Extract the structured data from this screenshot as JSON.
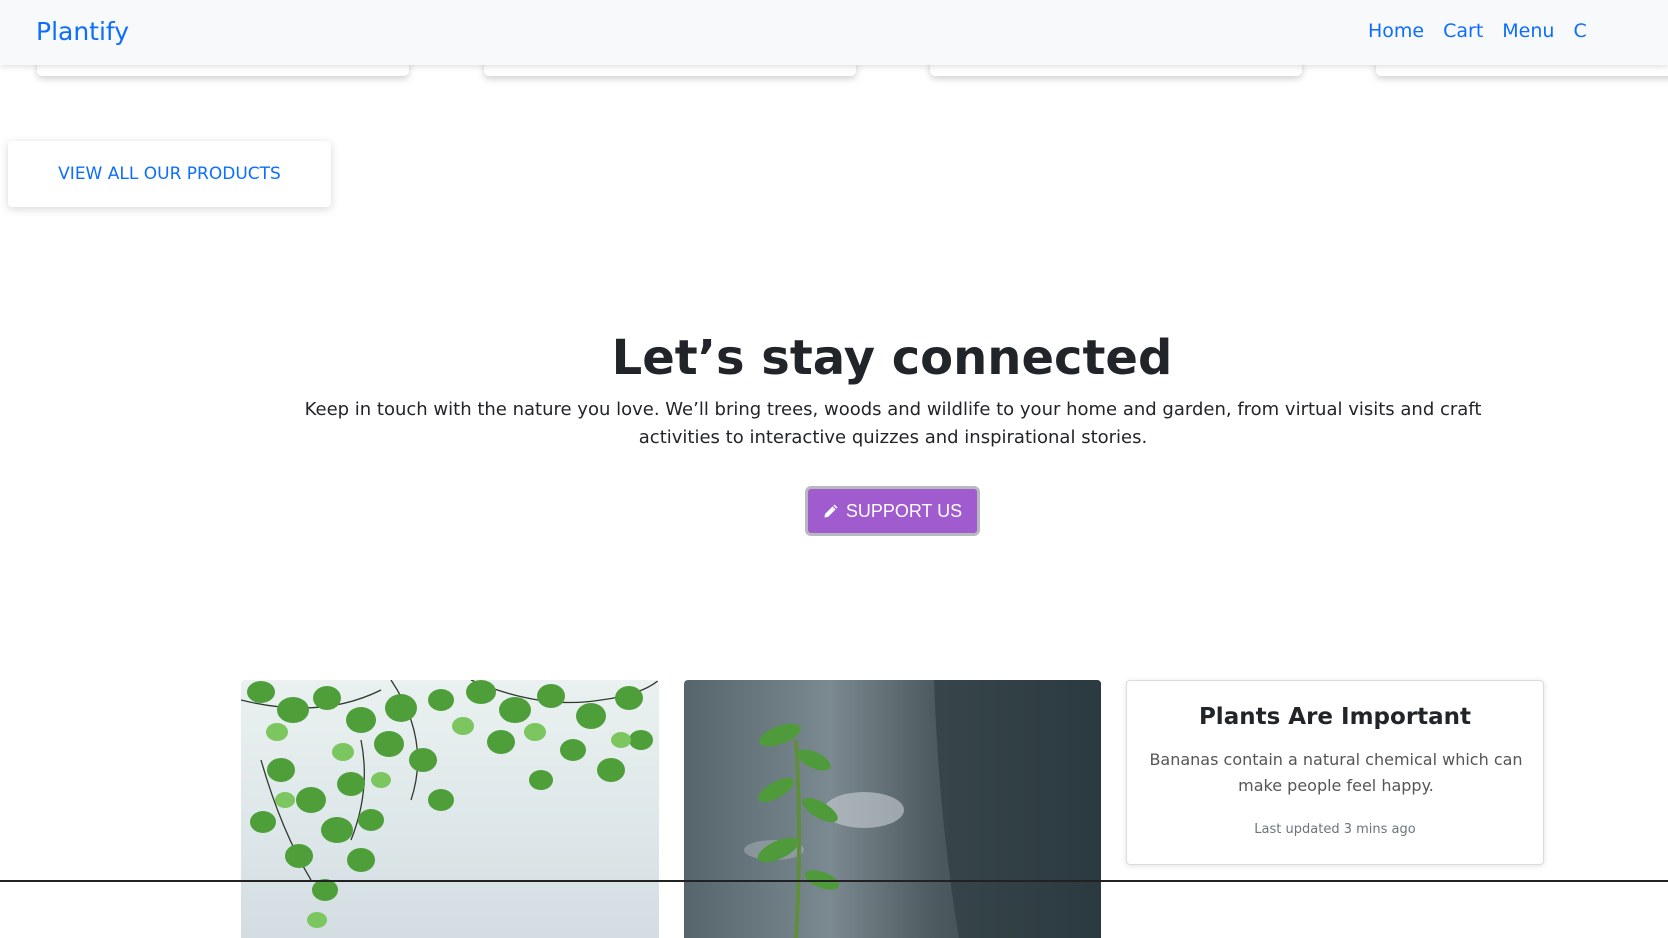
{
  "navbar": {
    "brand": "Plantify",
    "links": [
      "Home",
      "Cart",
      "Menu",
      "C"
    ]
  },
  "products": {
    "view_all_label": "VIEW ALL OUR PRODUCTS"
  },
  "connect": {
    "title": "Let’s stay connected",
    "text": "Keep in touch with the nature you love. We’ll bring trees, woods and wildlife to your home and garden, from virtual visits and craft activities to interactive quizzes and inspirational stories.",
    "button_label": "SUPPORT US",
    "button_icon": "pencil-icon",
    "button_color": "#a05bce"
  },
  "info_card": {
    "title": "Plants Are Important",
    "text": "Bananas contain a natural chemical which can make people feel happy.",
    "meta": "Last updated 3 mins ago"
  },
  "colors": {
    "accent": "#0d6efd",
    "navbar_bg": "#f8f9fa"
  }
}
